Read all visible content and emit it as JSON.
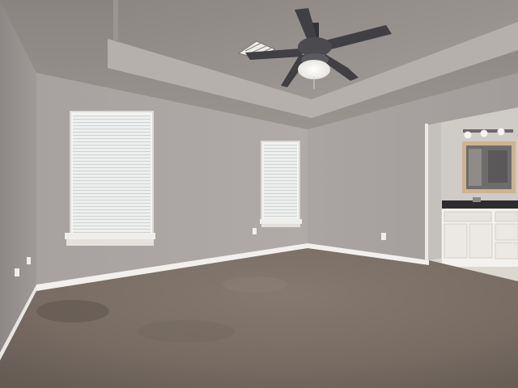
{
  "scene": {
    "type": "empty-bedroom-photo",
    "wall_color": "#a9a3a2",
    "ceiling_color": "#8f8986",
    "carpet_color": "#7d7168",
    "trim_color": "#f2f0ec",
    "fan_color": "#3f3f44",
    "vanity_color": "#f4f2ee",
    "countertop_color": "#2e2c2e",
    "mirror_frame_color": "#c9b58e",
    "floor_tile_color": "#ddd8cf"
  },
  "objects": [
    "tray-ceiling",
    "ceiling-fan",
    "hvac-vent",
    "window-left",
    "window-center",
    "doorway-bathroom",
    "bathroom-vanity",
    "vanity-mirror",
    "vanity-light-fixture",
    "carpet-floor",
    "baseboard-trim",
    "electrical-outlets"
  ]
}
